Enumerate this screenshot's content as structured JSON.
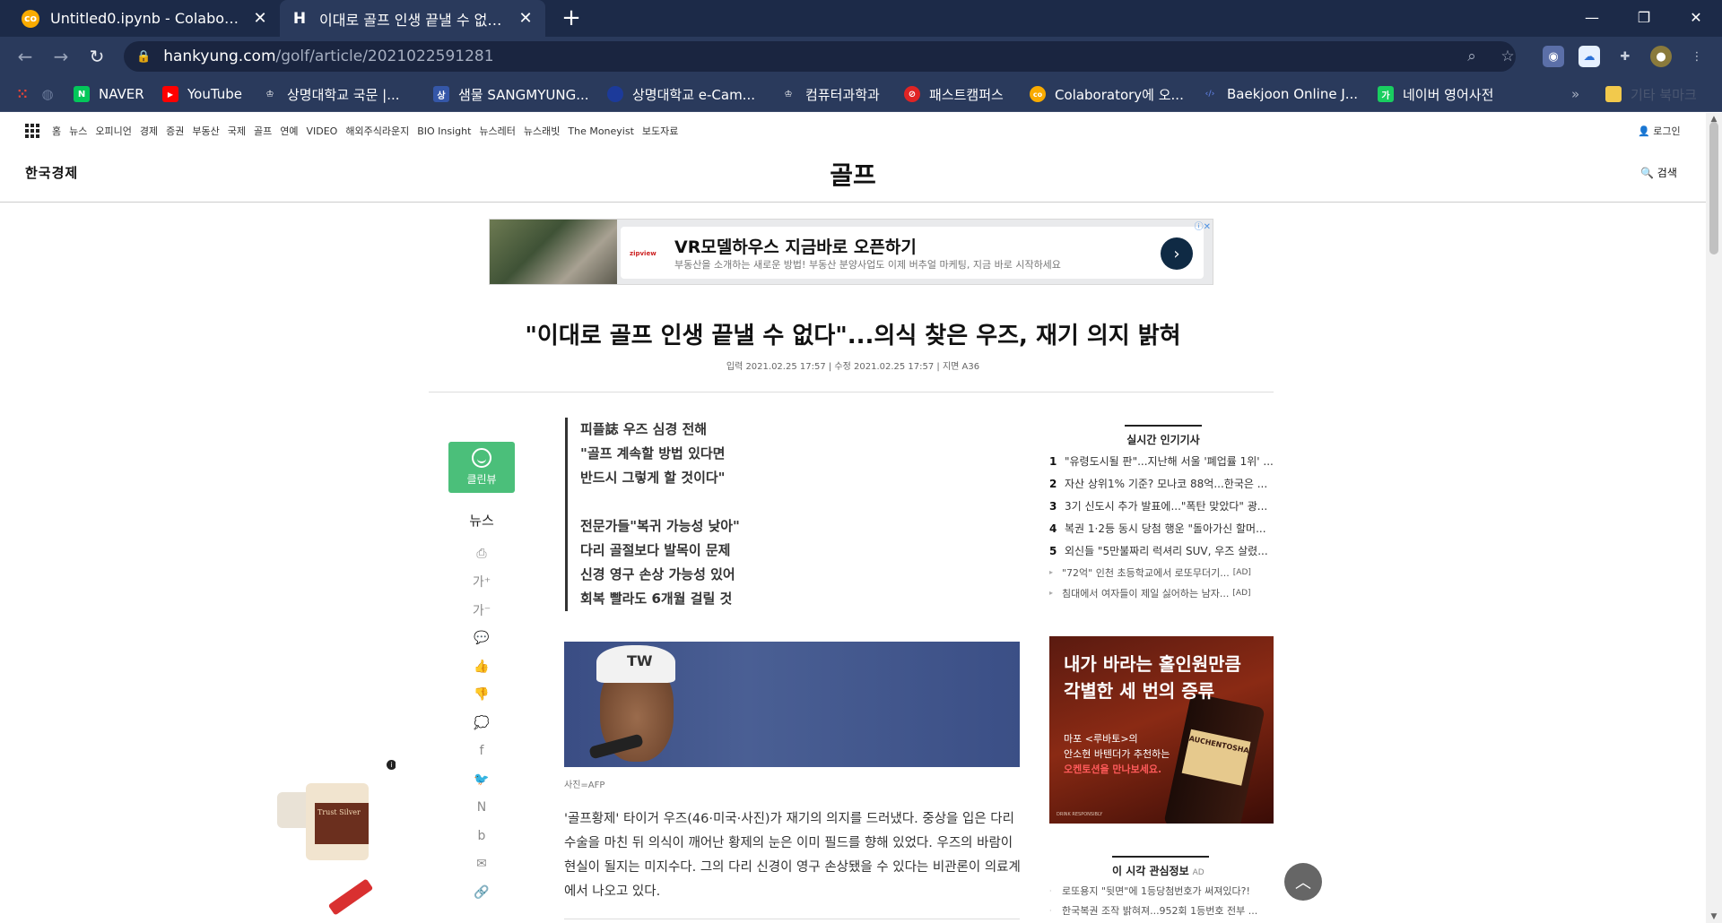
{
  "browser": {
    "tabs": [
      {
        "title": "Untitled0.ipynb - Colaboratory",
        "icon": "colab-icon",
        "active": false
      },
      {
        "title": "이대로 골프 인생 끝낼 수 없다...",
        "icon": "hankyung-icon",
        "active": true
      }
    ],
    "close_glyph": "✕",
    "new_tab_glyph": "+",
    "window_controls": {
      "minimize": "—",
      "restore": "❐",
      "close": "✕"
    },
    "url": {
      "host": "hankyung.com",
      "path": "/golf/article/2021022591281"
    },
    "bookmarks": [
      {
        "label": "",
        "icon": "apps-icon",
        "color": "#ea4335"
      },
      {
        "label": "",
        "icon": "globe-icon",
        "color": "#34a853"
      },
      {
        "label": "NAVER",
        "icon": "naver-icon",
        "color": "#03c75a",
        "glyph": "N"
      },
      {
        "label": "YouTube",
        "icon": "youtube-icon",
        "color": "#ff0000",
        "glyph": "▶"
      },
      {
        "label": "상명대학교 국문 |...",
        "icon": "sangmyung-icon",
        "color": "#2a3a5c",
        "glyph": "♔"
      },
      {
        "label": "샘물 SANGMYUNG...",
        "icon": "samul-icon",
        "color": "#3557a8",
        "glyph": "상"
      },
      {
        "label": "상명대학교 e-Cam...",
        "icon": "ecampus-icon",
        "color": "#1c3a9a",
        "glyph": "●"
      },
      {
        "label": "컴퓨터과학과",
        "icon": "cs-dept-icon",
        "color": "#2a3a5c",
        "glyph": "♔"
      },
      {
        "label": "패스트캠퍼스",
        "icon": "fastcampus-icon",
        "color": "#e02424",
        "glyph": "⊘"
      },
      {
        "label": "Colaboratory에 오...",
        "icon": "colab-icon",
        "color": "#f9ab00",
        "glyph": "co"
      },
      {
        "label": "Baekjoon Online J...",
        "icon": "baekjoon-icon",
        "color": "#2a3a5c",
        "glyph": "‹/›"
      },
      {
        "label": "네이버 영어사전",
        "icon": "naver-dict-icon",
        "color": "#19ce60",
        "glyph": "가"
      }
    ],
    "overflow_glyph": "»",
    "other_bookmarks": "기타 북마크"
  },
  "site": {
    "topnav": [
      "홈",
      "뉴스",
      "오피니언",
      "경제",
      "증권",
      "부동산",
      "국제",
      "골프",
      "연예",
      "VIDEO",
      "해외주식라운지",
      "BIO Insight",
      "뉴스레터",
      "뉴스래빗",
      "The Moneyist",
      "보도자료"
    ],
    "login": "로그인",
    "logo": "한국경제",
    "section": "골프",
    "search": "검색"
  },
  "ad_banner": {
    "brand": "zipview",
    "headline": "VR모델하우스 지금바로 오픈하기",
    "sub": "부동산을 소개하는 새로운 방법! 부동산 분양사업도 이제 버추얼 마케팅, 지금 바로 시작하세요",
    "go": "›"
  },
  "article": {
    "headline": "\"이대로 골프 인생 끝낼 수 없다\"...의식 찾은 우즈, 재기 의지 밝혀",
    "dateline": "입력 2021.02.25 17:57 | 수정 2021.02.25 17:57 | 지면 A36",
    "summary_a": [
      "피플誌 우즈 심경 전해",
      "\"골프 계속할 방법 있다면",
      "반드시 그렇게 할 것이다\""
    ],
    "summary_b": [
      "전문가들\"복귀 가능성 낮아\"",
      "다리 골절보다 발목이 문제",
      "신경 영구 손상 가능성 있어",
      "회복 빨라도 6개월 걸릴 것"
    ],
    "photo_credit": "사진=AFP",
    "cap_mark": "TW",
    "body": "'골프황제' 타이거 우즈(46·미국·사진)가 재기의 의지를 드러냈다. 중상을 입은 다리 수술을 마친 뒤 의식이 깨어난 황제의 눈은 이미 필드를 향해 있었다. 우즈의 바람이 현실이 될지는 미지수다. 그의 다리 신경이 영구 손상됐을 수 있다는 비관론이 의료계에서 나오고 있다."
  },
  "side": {
    "clean_view": "클린뷰",
    "news_label": "뉴스",
    "tools": [
      {
        "icon": "print-icon",
        "glyph": "⎙"
      },
      {
        "icon": "font-up-icon",
        "glyph": "가⁺"
      },
      {
        "icon": "font-down-icon",
        "glyph": "가⁻"
      },
      {
        "icon": "comment-icon",
        "glyph": "💬"
      },
      {
        "icon": "thumbs-up-icon",
        "glyph": "👍"
      },
      {
        "icon": "thumbs-down-icon",
        "glyph": "👎"
      },
      {
        "icon": "talk-icon",
        "glyph": "💭"
      },
      {
        "icon": "facebook-icon",
        "glyph": "f"
      },
      {
        "icon": "twitter-icon",
        "glyph": "🐦"
      },
      {
        "icon": "naver-blog-icon",
        "glyph": "N"
      },
      {
        "icon": "band-icon",
        "glyph": "b"
      },
      {
        "icon": "mail-icon",
        "glyph": "✉"
      },
      {
        "icon": "link-icon",
        "glyph": "🔗"
      }
    ]
  },
  "popular": {
    "title": "실시간 인기기사",
    "items": [
      {
        "rank": "1",
        "title": "\"유령도시될 판\"...지난해 서울 '폐업률 1위' ..."
      },
      {
        "rank": "2",
        "title": "자산 상위1% 기준? 모나코 88억...한국은 ..."
      },
      {
        "rank": "3",
        "title": "3기 신도시 추가 발표에...\"폭탄 맞았다\" 광..."
      },
      {
        "rank": "4",
        "title": "복권 1·2등 동시 당첨 행운 \"돌아가신 할머..."
      },
      {
        "rank": "5",
        "title": "외신들 \"5만불짜리 럭셔리 SUV, 우즈 살렸..."
      }
    ],
    "ads": [
      {
        "title": "\"72억\" 인천 초등학교에서 로또무더기...",
        "tag": "[AD]"
      },
      {
        "title": "침대에서 여자들이 제일 싫어하는 남자...",
        "tag": "[AD]"
      }
    ]
  },
  "whisky_ad": {
    "headline": [
      "내가 바라는 홀인원만큼",
      "각별한 세 번의 증류"
    ],
    "sub": [
      "마포 <루바토>의",
      "안소현 바텐더가 추천하는"
    ],
    "cta": "오켄토션을 만나보세요.",
    "bottle_label": "AUCHENTOSHAN",
    "fine": "DRINK RESPONSIBLY"
  },
  "interest": {
    "title": "이 시각 관심정보",
    "ad": "AD",
    "items": [
      {
        "title": "로또용지 \"뒷면\"에 1등당첨번호가 써져있다?!"
      },
      {
        "title": "한국복권 조작 밝혀져...952회 1등번호 전부 ..."
      }
    ]
  },
  "left_ad": {
    "label": "Trust Silver",
    "info": "i"
  },
  "to_top": "︿"
}
